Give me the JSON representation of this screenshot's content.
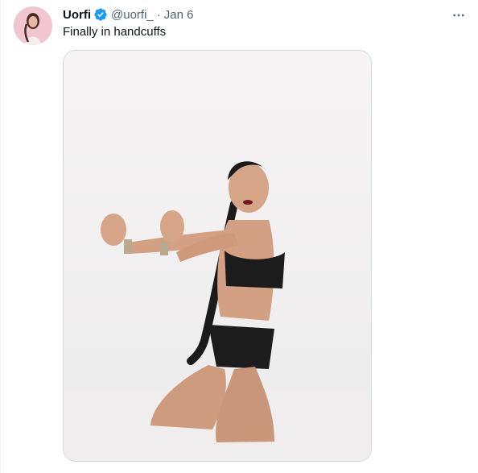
{
  "tweet": {
    "author_name": "Uorfi",
    "handle": "@uorfi_",
    "separator": "·",
    "date": "Jan 6",
    "text": "Finally in handcuffs",
    "verified_icon": "verified-badge-icon",
    "more_icon": "more-options-icon"
  },
  "colors": {
    "verified": "#1d9bf0",
    "secondary_text": "#536471",
    "primary_text": "#0f1419",
    "media_border": "#cfd9de"
  }
}
